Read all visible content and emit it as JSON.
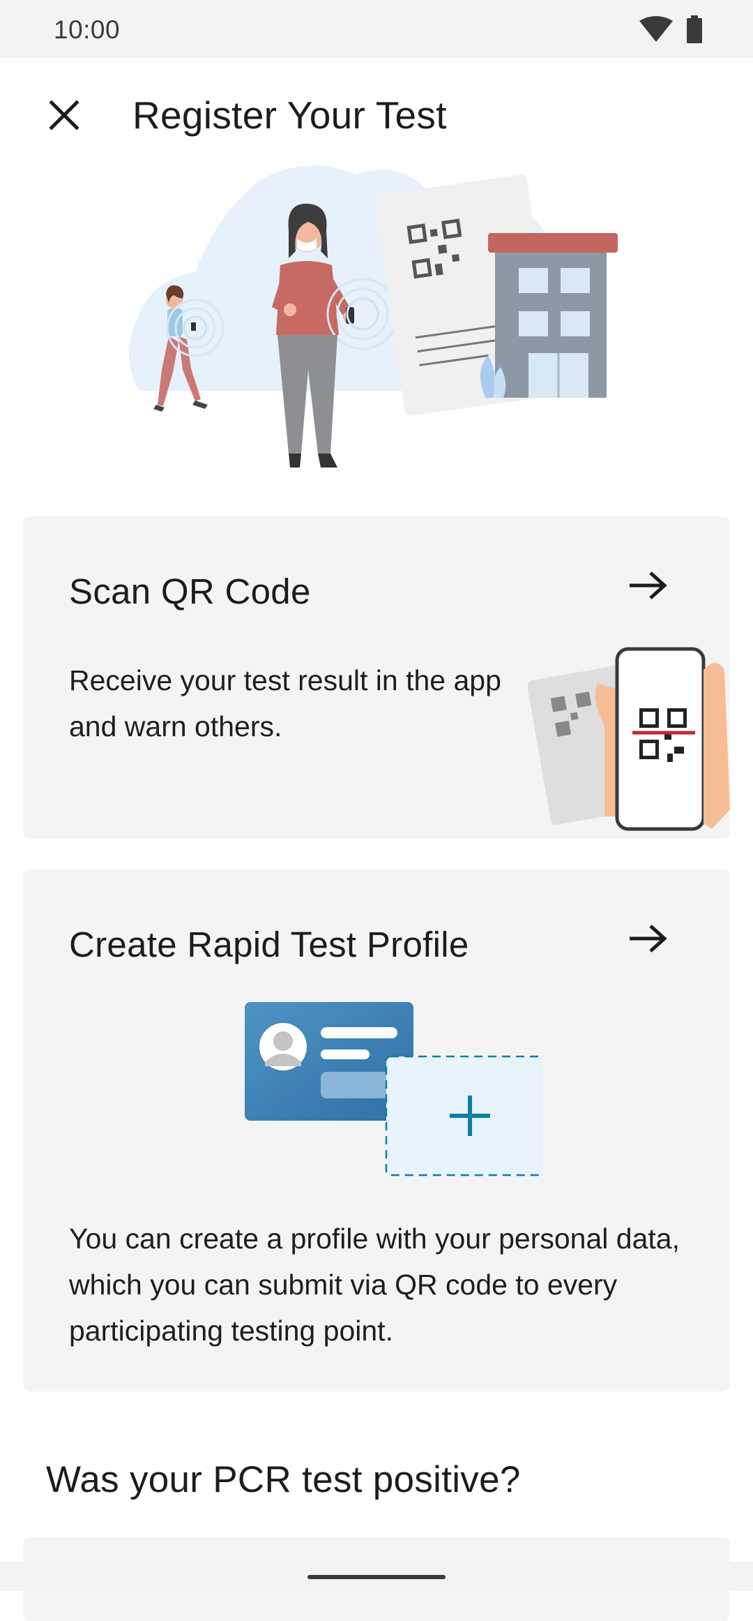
{
  "status_bar": {
    "time": "10:00",
    "icons": [
      "wifi-icon",
      "battery-icon"
    ]
  },
  "app_bar": {
    "title": "Register Your Test",
    "close_icon": "close-icon"
  },
  "cards": {
    "scan": {
      "title": "Scan QR Code",
      "body": "Receive your test result in the app and warn others.",
      "arrow_icon": "arrow-right-icon"
    },
    "profile": {
      "title": "Create Rapid Test Profile",
      "body": "You can create a profile with your personal data, which you can submit via QR code to every participating testing point.",
      "arrow_icon": "arrow-right-icon"
    }
  },
  "pcr_section": {
    "heading": "Was your PCR test positive?"
  },
  "colors": {
    "card_background": "#f4f4f4",
    "accent_blue": "#0b7fa8",
    "text_primary": "#1c1c1c"
  }
}
